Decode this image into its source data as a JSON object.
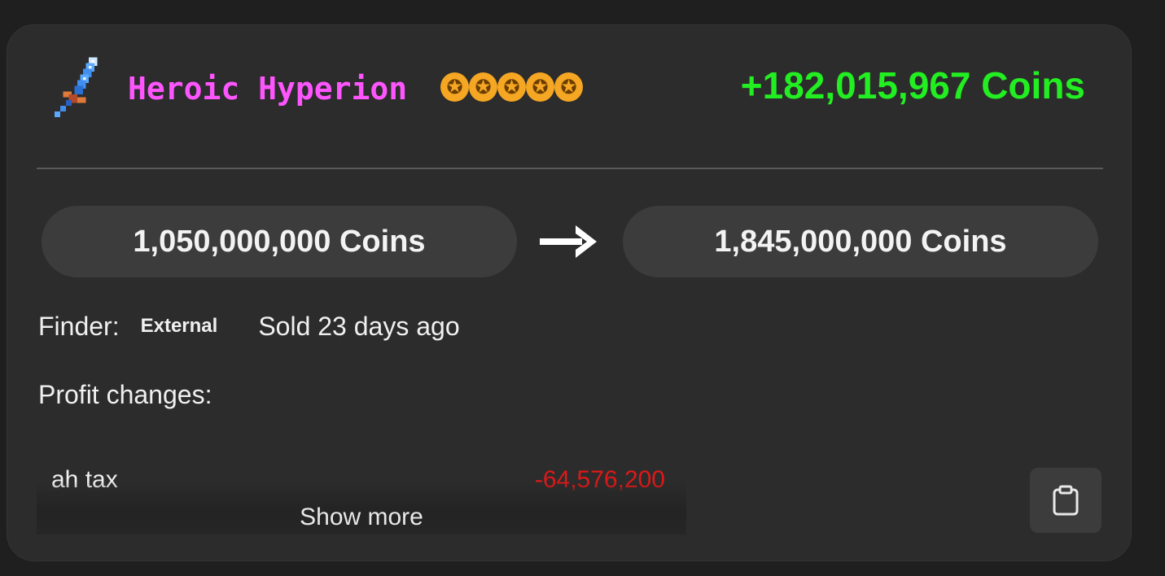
{
  "item": {
    "name": "Heroic Hyperion",
    "name_color": "#ff55ff",
    "icon": "sword-icon",
    "stars": [
      "✪",
      "✪",
      "✪",
      "✪",
      "✪"
    ],
    "star_color": "#f5a623"
  },
  "profit": {
    "text": "+182,015,967 Coins",
    "color": "#22ee22"
  },
  "prices": {
    "buy": "1,050,000,000 Coins",
    "sell": "1,845,000,000 Coins",
    "arrow_icon": "arrow-right-icon"
  },
  "info": {
    "finder_label": "Finder:",
    "finder_value": "External",
    "sold": "Sold 23 days ago"
  },
  "profit_changes": {
    "label": "Profit changes:",
    "rows": [
      {
        "label": "ah tax",
        "value": "-64,576,200",
        "color": "#e01818"
      }
    ],
    "show_more": "Show more"
  },
  "actions": {
    "copy_icon": "clipboard-icon"
  }
}
